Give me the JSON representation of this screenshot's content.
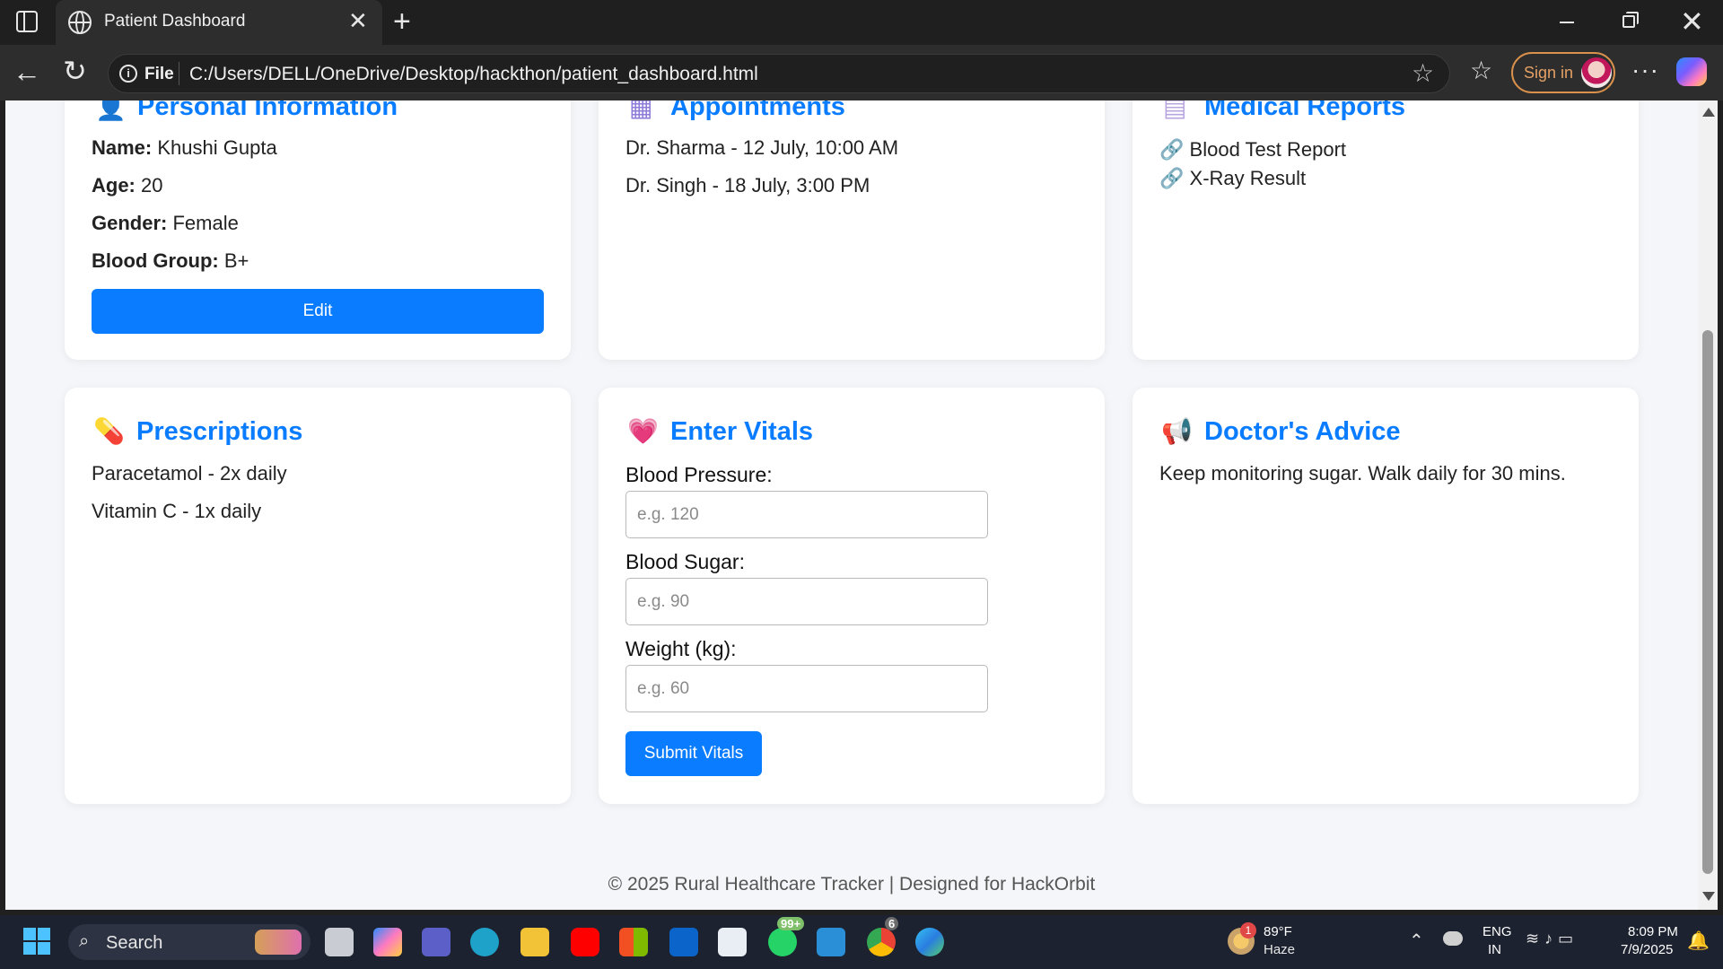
{
  "browser": {
    "tab_title": "Patient Dashboard",
    "file_label": "File",
    "url": "C:/Users/DELL/OneDrive/Desktop/hackthon/patient_dashboard.html",
    "signin_label": "Sign in"
  },
  "cards": {
    "personal": {
      "title": "Personal Information",
      "icon": "person-icon",
      "name_label": "Name:",
      "name_value": "Khushi Gupta",
      "age_label": "Age:",
      "age_value": "20",
      "gender_label": "Gender:",
      "gender_value": "Female",
      "blood_label": "Blood Group:",
      "blood_value": "B+",
      "edit_label": "Edit"
    },
    "appointments": {
      "title": "Appointments",
      "icon": "calendar-icon",
      "items": [
        "Dr. Sharma - 12 July, 10:00 AM",
        "Dr. Singh - 18 July, 3:00 PM"
      ]
    },
    "reports": {
      "title": "Medical Reports",
      "icon": "document-icon",
      "items": [
        "Blood Test Report",
        "X-Ray Result"
      ]
    },
    "prescriptions": {
      "title": "Prescriptions",
      "icon": "pill-icon",
      "items": [
        "Paracetamol - 2x daily",
        "Vitamin C - 1x daily"
      ]
    },
    "vitals": {
      "title": "Enter Vitals",
      "icon": "heart-icon",
      "bp_label": "Blood Pressure:",
      "bp_placeholder": "e.g. 120",
      "sugar_label": "Blood Sugar:",
      "sugar_placeholder": "e.g. 90",
      "weight_label": "Weight (kg):",
      "weight_placeholder": "e.g. 60",
      "submit_label": "Submit Vitals"
    },
    "advice": {
      "title": "Doctor's Advice",
      "icon": "megaphone-icon",
      "text": "Keep monitoring sugar. Walk daily for 30 mins."
    }
  },
  "footer": "© 2025 Rural Healthcare Tracker | Designed for HackOrbit",
  "taskbar": {
    "search_label": "Search",
    "whatsapp_badge": "99+",
    "chrome_badge": "6",
    "weather_badge": "1",
    "weather_temp": "89°F",
    "weather_desc": "Haze",
    "lang_line1": "ENG",
    "lang_line2": "IN",
    "time": "8:09 PM",
    "date": "7/9/2025"
  },
  "colors": {
    "accent": "#0a7cff",
    "page_bg": "#f4f6f9",
    "taskbar_bg": "#1c2230"
  }
}
